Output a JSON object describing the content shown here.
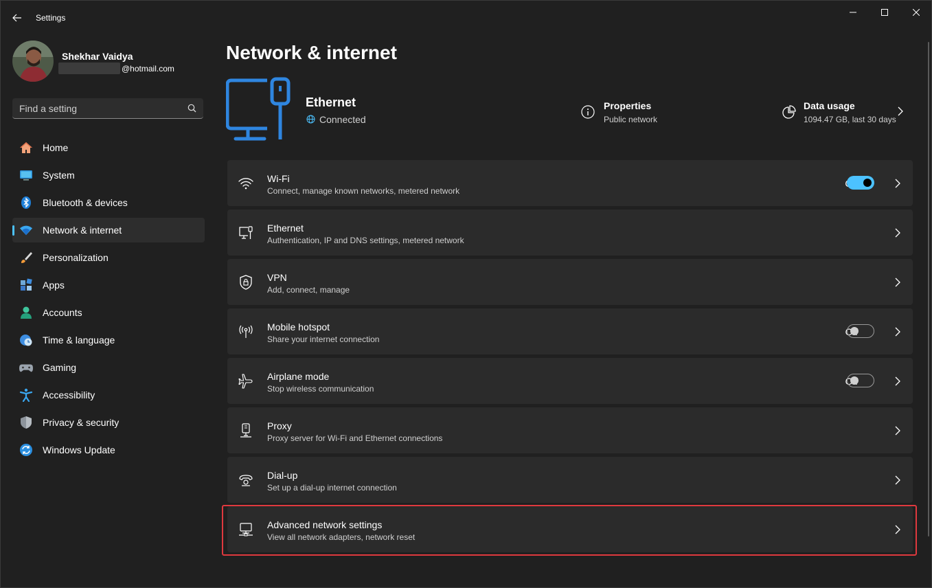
{
  "window": {
    "title": "Settings",
    "controls": [
      "minimize-icon",
      "maximize-icon",
      "close-icon"
    ]
  },
  "user": {
    "name": "Shekhar Vaidya",
    "email_domain": "@hotmail.com"
  },
  "search": {
    "placeholder": "Find a setting",
    "value": ""
  },
  "sidebar": {
    "items": [
      {
        "label": "Home",
        "icon": "home-icon"
      },
      {
        "label": "System",
        "icon": "system-icon"
      },
      {
        "label": "Bluetooth & devices",
        "icon": "bluetooth-icon"
      },
      {
        "label": "Network & internet",
        "icon": "wifi-icon",
        "active": true
      },
      {
        "label": "Personalization",
        "icon": "brush-icon"
      },
      {
        "label": "Apps",
        "icon": "apps-icon"
      },
      {
        "label": "Accounts",
        "icon": "accounts-icon"
      },
      {
        "label": "Time & language",
        "icon": "clock-globe-icon"
      },
      {
        "label": "Gaming",
        "icon": "gamepad-icon"
      },
      {
        "label": "Accessibility",
        "icon": "accessibility-icon"
      },
      {
        "label": "Privacy & security",
        "icon": "shield-icon"
      },
      {
        "label": "Windows Update",
        "icon": "update-icon"
      }
    ]
  },
  "main": {
    "title": "Network & internet",
    "hero": {
      "name": "Ethernet",
      "status": "Connected"
    },
    "properties": {
      "title": "Properties",
      "subtitle": "Public network"
    },
    "data_usage": {
      "title": "Data usage",
      "subtitle": "1094.47 GB, last 30 days"
    },
    "cards": [
      {
        "title": "Wi-Fi",
        "subtitle": "Connect, manage known networks, metered network",
        "icon": "wifi-icon",
        "toggle": "On"
      },
      {
        "title": "Ethernet",
        "subtitle": "Authentication, IP and DNS settings, metered network",
        "icon": "ethernet-icon"
      },
      {
        "title": "VPN",
        "subtitle": "Add, connect, manage",
        "icon": "vpn-shield-icon"
      },
      {
        "title": "Mobile hotspot",
        "subtitle": "Share your internet connection",
        "icon": "hotspot-icon",
        "toggle": "Off"
      },
      {
        "title": "Airplane mode",
        "subtitle": "Stop wireless communication",
        "icon": "airplane-icon",
        "toggle": "Off"
      },
      {
        "title": "Proxy",
        "subtitle": "Proxy server for Wi-Fi and Ethernet connections",
        "icon": "proxy-icon"
      },
      {
        "title": "Dial-up",
        "subtitle": "Set up a dial-up internet connection",
        "icon": "dialup-icon"
      },
      {
        "title": "Advanced network settings",
        "subtitle": "View all network adapters, network reset",
        "icon": "advanced-network-icon",
        "highlighted": true
      }
    ]
  },
  "colors": {
    "accent": "#4cc2ff",
    "background": "#202020",
    "card": "#2b2b2b",
    "highlight": "#e0393e"
  }
}
